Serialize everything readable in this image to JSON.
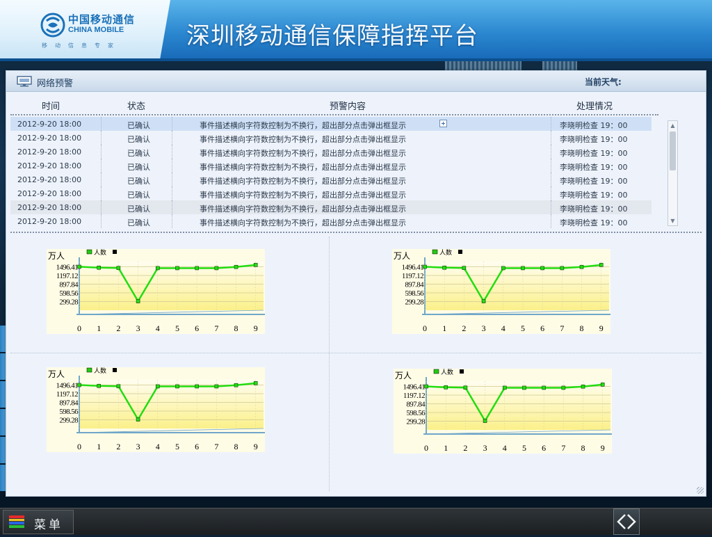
{
  "header": {
    "logo_cn": "中国移动通信",
    "logo_en": "CHINA MOBILE",
    "logo_tagline": "移动信息专家",
    "title": "深圳移动通信保障指挥平台"
  },
  "window": {
    "title": "网络预警",
    "weather_label": "当前天气:"
  },
  "table": {
    "columns": [
      "时间",
      "状态",
      "预警内容",
      "处理情况"
    ],
    "rows": [
      {
        "time": "2012-9-20 18:00",
        "status": "已确认",
        "content": "事件描述横向字符数控制为不换行，超出部分点击弹出框显示",
        "handling": "李晓明检查 19：00"
      },
      {
        "time": "2012-9-20 18:00",
        "status": "已确认",
        "content": "事件描述横向字符数控制为不换行，超出部分点击弹出框显示",
        "handling": "李晓明检查 19：00"
      },
      {
        "time": "2012-9-20 18:00",
        "status": "已确认",
        "content": "事件描述横向字符数控制为不换行，超出部分点击弹出框显示",
        "handling": "李晓明检查 19：00"
      },
      {
        "time": "2012-9-20 18:00",
        "status": "已确认",
        "content": "事件描述横向字符数控制为不换行，超出部分点击弹出框显示",
        "handling": "李晓明检查 19：00"
      },
      {
        "time": "2012-9-20 18:00",
        "status": "已确认",
        "content": "事件描述横向字符数控制为不换行，超出部分点击弹出框显示",
        "handling": "李晓明检查 19：00"
      },
      {
        "time": "2012-9-20 18:00",
        "status": "已确认",
        "content": "事件描述横向字符数控制为不换行，超出部分点击弹出框显示",
        "handling": "李晓明检查 19：00"
      },
      {
        "time": "2012-9-20 18:00",
        "status": "已确认",
        "content": "事件描述横向字符数控制为不换行，超出部分点击弹出框显示",
        "handling": "李晓明检查 19：00"
      },
      {
        "time": "2012-9-20 18:00",
        "status": "已确认",
        "content": "事件描述横向字符数控制为不换行，超出部分点击弹出框显示",
        "handling": "李晓明检查 19：00"
      }
    ]
  },
  "chart_data": {
    "type": "line",
    "unit_label": "万人",
    "legend": [
      {
        "name": "人数",
        "color": "#22cc11"
      },
      {
        "name": "",
        "color": "#000000"
      }
    ],
    "x": [
      0,
      1,
      2,
      3,
      4,
      5,
      6,
      7,
      8,
      9
    ],
    "yticks": [
      299.28,
      598.56,
      897.84,
      1197.12,
      1496.41
    ],
    "ylim": [
      0,
      1496.41
    ],
    "series": [
      {
        "name": "人数",
        "values": [
          1496.41,
          1465,
          1455,
          310,
          1450,
          1450,
          1450,
          1450,
          1490,
          1560
        ]
      }
    ],
    "colors": {
      "line": "#22dd11",
      "fill_top": "#fffdf0",
      "fill_bottom": "#fbf08a",
      "axis": "#6fa6c9"
    }
  },
  "bottom_bar": {
    "menu_label": "菜单"
  },
  "icons": {
    "logo": "china-mobile-logo",
    "window": "monitor-icon",
    "menu": "menu-stripes-icon",
    "nav": "prev-next-arrows-icon"
  }
}
